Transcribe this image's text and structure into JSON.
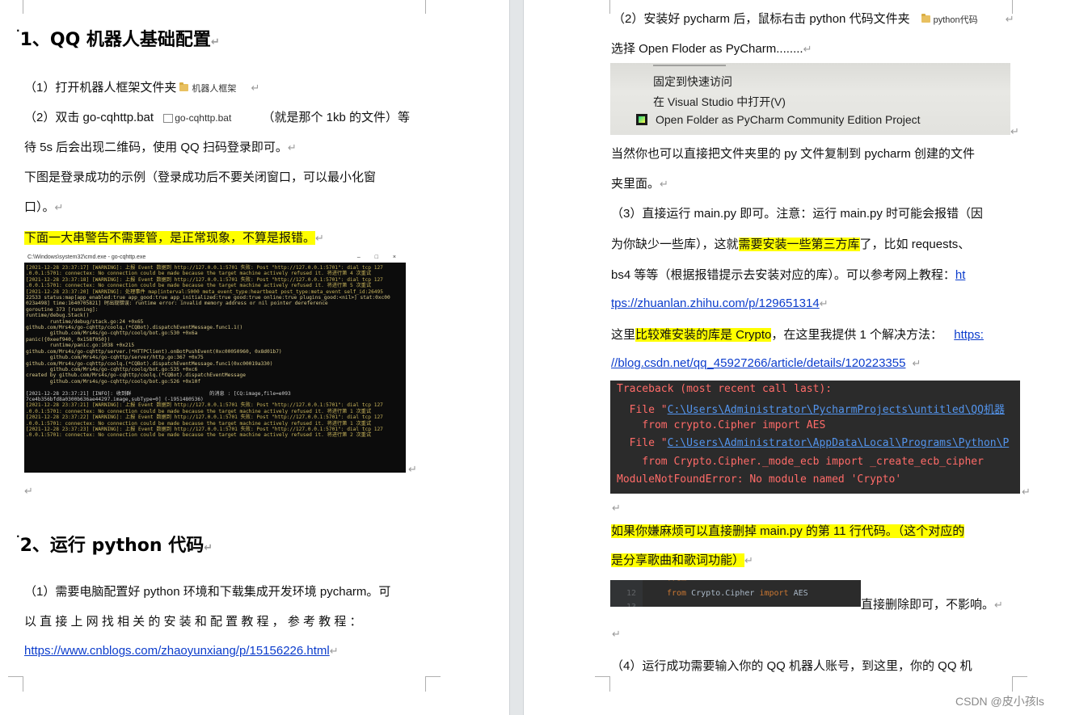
{
  "left_page": {
    "heading1": "1、QQ 机器人基础配置",
    "step1_text": "（1）打开机器人框架文件夹",
    "step1_folder": "机器人框架",
    "step2_text_a": "（2）双击 go-cqhttp.bat",
    "step2_file": "go-cqhttp.bat",
    "step2_text_b": "（就是那个 1kb 的文件）等",
    "step2_text_c": "待 5s 后会出现二维码，使用 QQ 扫码登录即可。",
    "login_text_a": "下图是登录成功的示例（登录成功后不要关闭窗口，可以最小化窗",
    "login_text_b": "口）。",
    "warning_highlight": "下面一大串警告不需要管，是正常现象，不算是报错。",
    "cmd_title": "C:\\Windows\\system32\\cmd.exe - go-cqhttp.exe",
    "cmd_lines": [
      "[2021-12-28 23:37:17] [WARNING]: 上报 Event 数据到 http://127.0.0.1:5701 失败: Post \"http://127.0.0.1:5701\": dial tcp 127",
      ".0.0.1:5701: connectex: No connection could be made because the target machine actively refused it. 将进行第 4 次重试",
      "[2021-12-28 23:37:18] [WARNING]: 上报 Event 数据到 http://127.0.0.1:5701 失败: Post \"http://127.0.0.1:5701\": dial tcp 127",
      ".0.0.1:5701: connectex: No connection could be made because the target machine actively refused it. 将进行第 5 次重试",
      "[2021-12-28 23:37:20] [WARNING]: 处理事件 map[interval:5000 meta_event_type:heartbeat post_type:meta_event self_id:26495",
      "22533 status:map[app_enabled:true app_good:true app_initialized:true good:true online:true plugins_good:<nil>] stat:0xc00",
      "023a498] time:1640705821] 时出现错误: runtime error: invalid memory address or nil pointer dereference",
      "goroutine 373 [running]:",
      "runtime/debug.Stack()",
      "        runtime/debug/stack.go:24 +0x65",
      "github.com/Mrs4s/go-cqhttp/coolq.(*CQBot).dispatchEventMessage.func1.1()",
      "        github.com/Mrs4s/go-cqhttp/coolq/bot.go:530 +0x6a",
      "panic({0xeef940, 0x158f050})",
      "        runtime/panic.go:1038 +0x215",
      "github.com/Mrs4s/go-cqhttp/server.(*HTTPClient).onBotPushEvent(0xc00050960, 0x8d01b7)",
      "        github.com/Mrs4s/go-cqhttp/server/http.go:367 +0x75",
      "github.com/Mrs4s/go-cqhttp/coolq.(*CQBot).dispatchEventMessage.func1(0xc00019a330)",
      "        github.com/Mrs4s/go-cqhttp/coolq/bot.go:535 +0xc6",
      "created by github.com/Mrs4s/go-cqhttp/coolq.(*CQBot).dispatchEventMessage",
      "        github.com/Mrs4s/go-cqhttp/coolq/bot.go:526 +0x10f",
      "",
      "[2021-12-28 23:37:21] [INFO]: 收到群                          的消息 : [CQ:image,file=e093",
      "7ce4b356bfd8a0300b636ae44297.image,subType=0] (-1951480536)",
      "[2021-12-28 23:37:21] [WARNING]: 上报 Event 数据到 http://127.0.0.1:5701 失败: Post \"http://127.0.0.1:5701\": dial tcp 127",
      ".0.0.1:5701: connectex: No connection could be made because the target machine actively refused it. 将进行第 1 次重试",
      "[2021-12-28 23:37:22] [WARNING]: 上报 Event 数据到 http://127.0.0.1:5701 失败: Post \"http://127.0.0.1:5701\": dial tcp 127",
      ".0.0.1:5701: connectex: No connection could be made because the target machine actively refused it. 将进行第 1 次重试",
      "[2021-12-28 23:37:23] [WARNING]: 上报 Event 数据到 http://127.0.0.1:5701 失败: Post \"http://127.0.0.1:5701\": dial tcp 127",
      ".0.0.1:5701: connectex: No connection could be made because the target machine actively refused it. 将进行第 2 次重试"
    ],
    "heading2": "2、运行 python 代码",
    "python_text_a": "（1）需要电脑配置好 python 环境和下载集成开发环境 pycharm。可",
    "python_text_b": "以 直 接 上 网 找 相 关 的 安 装 和 配 置 教 程 ， 参 考 教 程 ：",
    "python_link": "https://www.cnblogs.com/zhaoyunxiang/p/15156226.html"
  },
  "right_page": {
    "p2_text": "（2）安装好 pycharm 后，鼠标右击 python 代码文件夹",
    "p2_folder": "python代码",
    "p2_text_b": "选择 Open Floder as PyCharm........",
    "menu_items": [
      "固定到快速访问",
      "在 Visual Studio 中打开(V)",
      "Open Folder as PyCharm Community Edition Project"
    ],
    "copy_text_a": "当然你也可以直接把文件夹里的 py 文件复制到 pycharm 创建的文件",
    "copy_text_b": "夹里面。",
    "p3_text_a": "（3）直接运行 main.py 即可。注意：运行 main.py 时可能会报错（因",
    "p3_text_b1": "为你缺少一些库），这就",
    "p3_text_b_hl": "需要安装一些第三方库",
    "p3_text_b2": "了，比如 requests、",
    "p3_text_c": "bs4 等等（根据报错提示去安装对应的库）。可以参考网上教程：",
    "p3_link_a": "ht",
    "p3_link_b": "tps://zhuanlan.zhihu.com/p/129651314",
    "crypto_text_a": "这里",
    "crypto_hl": "比较难安装的库是 Crypto",
    "crypto_text_b": "，在这里我提供 1 个解决方法：",
    "crypto_link_a": "https:",
    "crypto_link_b": "//blog.csdn.net/qq_45927266/article/details/120223355",
    "traceback": {
      "l1": "Traceback (most recent call last):",
      "l2_pre": "  File \"",
      "l2_path": "C:\\Users\\Administrator\\PycharmProjects\\untitled\\QQ机器",
      "l3": "    from crypto.Cipher import AES",
      "l4_pre": "  File \"",
      "l4_path": "C:\\Users\\Administrator\\AppData\\Local\\Programs\\Python\\P",
      "l5": "    from Crypto.Cipher._mode_ecb import _create_ecb_cipher",
      "l6": "ModuleNotFoundError: No module named 'Crypto'"
    },
    "delete_hl_a": "如果你嫌麻烦可以直接删掉 main.py 的第 11 行代码。（这个对应的",
    "delete_hl_b": "是分享歌曲和歌词功能）",
    "code": {
      "line_a": "12",
      "line_b": "13",
      "kw_from": "from",
      "module": "Crypto.Cipher",
      "kw_import": "import",
      "name": "AES"
    },
    "after_code": "直接删除即可，不影响。",
    "p4_text": "（4）运行成功需要输入你的 QQ 机器人账号，到这里，你的 QQ 机",
    "watermark": "CSDN @皮小孩ls"
  },
  "return_mark": "↵"
}
